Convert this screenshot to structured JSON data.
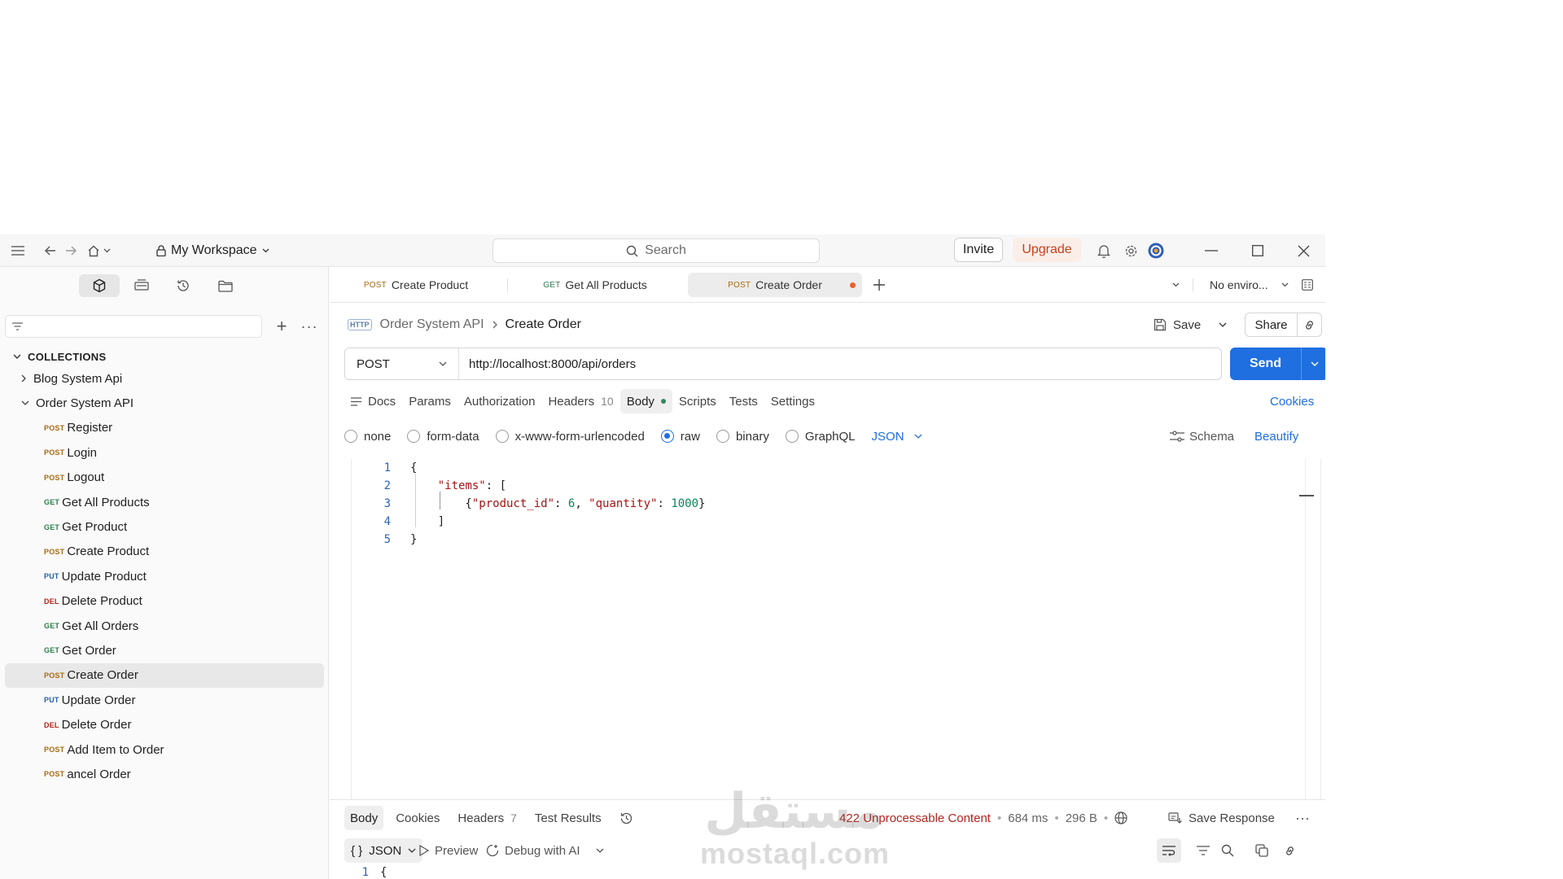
{
  "titlebar": {
    "workspace": "My Workspace",
    "search_label": "Search",
    "invite": "Invite",
    "upgrade": "Upgrade"
  },
  "sidebar": {
    "collections_heading": "COLLECTIONS",
    "folders": [
      {
        "name": "Blog System Api",
        "expanded": false
      },
      {
        "name": "Order System API",
        "expanded": true
      }
    ],
    "requests": [
      {
        "method": "POST",
        "name": "Register"
      },
      {
        "method": "POST",
        "name": "Login"
      },
      {
        "method": "POST",
        "name": "Logout"
      },
      {
        "method": "GET",
        "name": "Get All Products"
      },
      {
        "method": "GET",
        "name": "Get Product"
      },
      {
        "method": "POST",
        "name": "Create Product"
      },
      {
        "method": "PUT",
        "name": "Update Product"
      },
      {
        "method": "DEL",
        "name": "Delete Product"
      },
      {
        "method": "GET",
        "name": "Get All Orders"
      },
      {
        "method": "GET",
        "name": "Get Order"
      },
      {
        "method": "POST",
        "name": "Create Order",
        "selected": true
      },
      {
        "method": "PUT",
        "name": "Update Order"
      },
      {
        "method": "DEL",
        "name": "Delete Order"
      },
      {
        "method": "POST",
        "name": "Add Item to Order"
      },
      {
        "method": "POST",
        "name": "ancel Order"
      }
    ]
  },
  "tabs": [
    {
      "method": "POST",
      "label": "Create Product"
    },
    {
      "method": "GET",
      "label": "Get All Products"
    },
    {
      "method": "POST",
      "label": "Create Order",
      "active": true,
      "unsaved": true
    }
  ],
  "environment": "No enviro...",
  "breadcrumb": {
    "badge": "HTTP",
    "parent": "Order System API",
    "current": "Create Order"
  },
  "actions": {
    "save": "Save",
    "share": "Share"
  },
  "request": {
    "method": "POST",
    "url": "http://localhost:8000/api/orders",
    "send": "Send",
    "tabs": {
      "docs": "Docs",
      "params": "Params",
      "authorization": "Authorization",
      "headers": "Headers",
      "headers_count": "10",
      "body": "Body",
      "scripts": "Scripts",
      "tests": "Tests",
      "settings": "Settings"
    },
    "cookies": "Cookies",
    "body_types": {
      "none": "none",
      "form_data": "form-data",
      "urlencoded": "x-www-form-urlencoded",
      "raw": "raw",
      "binary": "binary",
      "graphql": "GraphQL",
      "selected": "raw",
      "language": "JSON"
    },
    "schema": "Schema",
    "beautify": "Beautify",
    "line_numbers": [
      "1",
      "2",
      "3",
      "4",
      "5"
    ]
  },
  "response": {
    "tabs": {
      "body": "Body",
      "cookies": "Cookies",
      "headers": "Headers",
      "headers_count": "7",
      "test_results": "Test Results"
    },
    "status": "422 Unprocessable Content",
    "time": "684 ms",
    "size": "296 B",
    "save_response": "Save Response",
    "format": "JSON",
    "preview": "Preview",
    "debug": "Debug with AI",
    "first_line_number": "1",
    "first_line": "{"
  },
  "watermark": {
    "arabic": "مستقل",
    "latin": "mostaql.com"
  },
  "colors": {
    "accent_blue": "#1f6fe0",
    "upgrade_orange": "#c8411b",
    "error_red": "#b3261e",
    "post": "#a86b12",
    "get": "#2e7d4f",
    "put": "#285fa8",
    "delete": "#b3261e"
  }
}
